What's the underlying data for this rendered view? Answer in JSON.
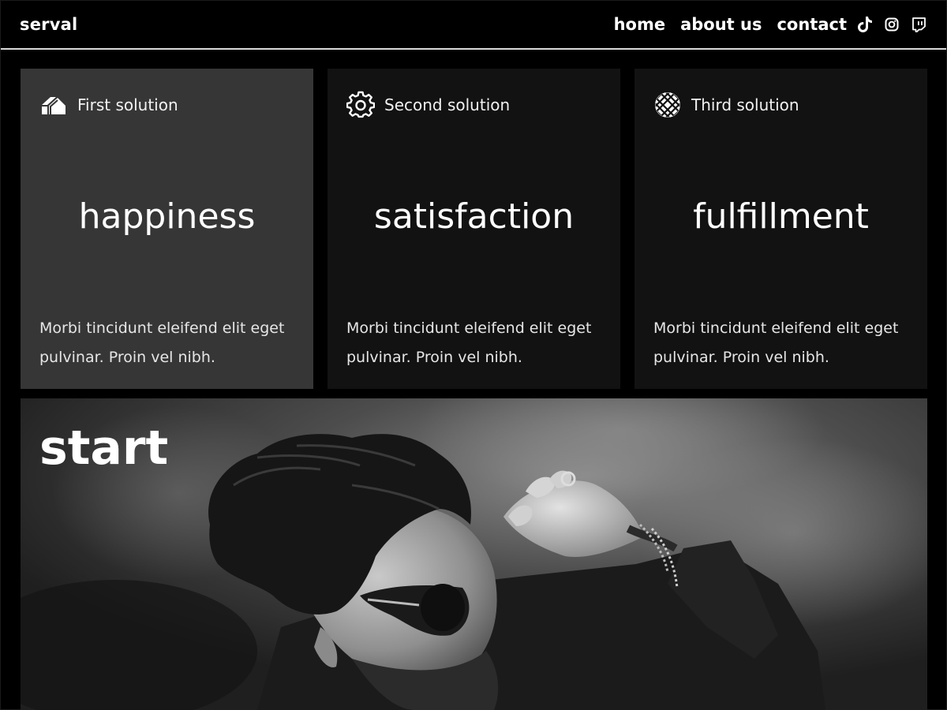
{
  "header": {
    "brand": "serval",
    "nav": [
      {
        "label": "home"
      },
      {
        "label": "about us"
      },
      {
        "label": "contact"
      }
    ],
    "social": [
      "tiktok-icon",
      "instagram-icon",
      "twitch-icon"
    ]
  },
  "solutions": [
    {
      "title": "First solution",
      "icon": "home-icon",
      "headline": "happiness",
      "body": "Morbi tincidunt eleifend elit eget pulvinar. Proin vel nibh."
    },
    {
      "title": "Second solution",
      "icon": "gear-icon",
      "headline": "satisfaction",
      "body": "Morbi tincidunt eleifend elit eget pulvinar. Proin vel nibh."
    },
    {
      "title": "Third solution",
      "icon": "grid-ball-icon",
      "headline": "fulfillment",
      "body": "Morbi tincidunt eleifend elit eget pulvinar. Proin vel nibh."
    }
  ],
  "hero": {
    "title": "start",
    "image": "black-and-white-photo-man-with-sunglasses"
  },
  "colors": {
    "background": "#000000",
    "card": "#121212",
    "card_active": "#363636",
    "text": "#ffffff"
  }
}
